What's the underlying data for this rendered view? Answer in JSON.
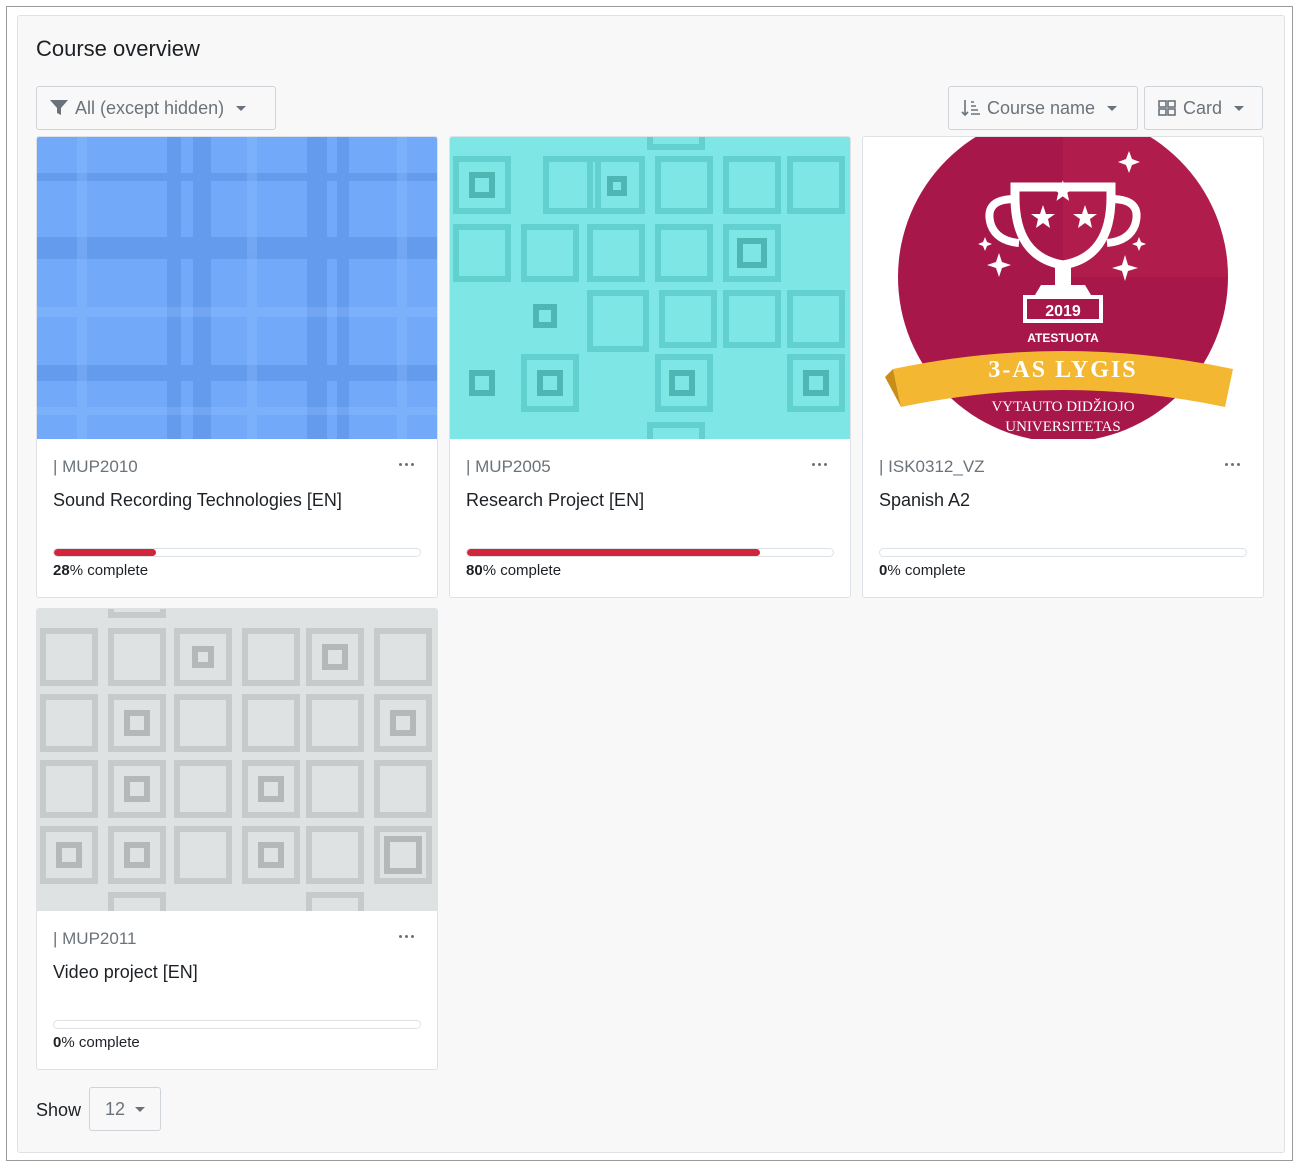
{
  "block": {
    "title": "Course overview"
  },
  "filter": {
    "label": "All (except hidden)",
    "icon": "filter-icon"
  },
  "sort": {
    "label": "Course name",
    "icon": "sort-icon"
  },
  "view": {
    "label": "Card",
    "icon": "grid-icon"
  },
  "colors": {
    "progress": "#d0253a",
    "muted": "#6a737b",
    "text": "#1d2125"
  },
  "courses": [
    {
      "code": "| MUP2010",
      "name": "Sound Recording Technologies [EN]",
      "progress": 28,
      "progress_number": "28",
      "progress_suffix": "% complete",
      "image": "plaid-blue-pattern"
    },
    {
      "code": "| MUP2005",
      "name": "Research Project [EN]",
      "progress": 80,
      "progress_number": "80",
      "progress_suffix": "% complete",
      "image": "teal-squares-pattern"
    },
    {
      "code": "| ISK0312_VZ",
      "name": "Spanish A2",
      "progress": 0,
      "progress_number": "0",
      "progress_suffix": "% complete",
      "image": "trophy-badge",
      "badge": {
        "year": "2019",
        "certified": "ATESTUOTA",
        "level": "3-AS LYGIS",
        "university_line1": "VYTAUTO DIDŽIOJO",
        "university_line2": "UNIVERSITETAS"
      }
    },
    {
      "code": "| MUP2011",
      "name": "Video project [EN]",
      "progress": 0,
      "progress_number": "0",
      "progress_suffix": "% complete",
      "image": "grey-squares-pattern"
    }
  ],
  "paging": {
    "show_label": "Show",
    "value": "12"
  }
}
